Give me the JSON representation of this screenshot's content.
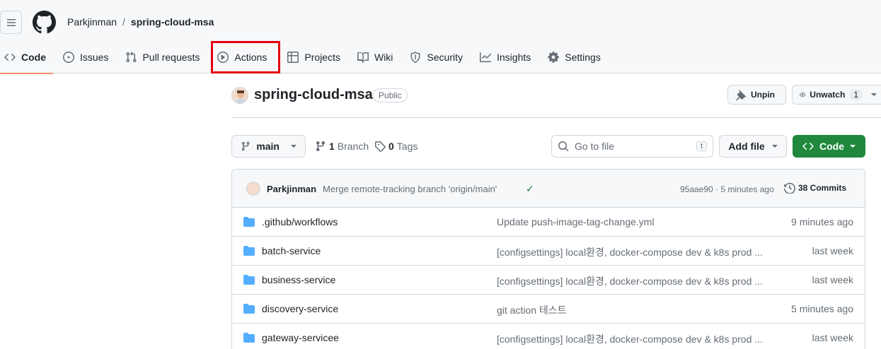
{
  "header": {
    "owner": "Parkjinman",
    "separator": "/",
    "repo": "spring-cloud-msa"
  },
  "tabs": [
    {
      "label": "Code",
      "icon": "code-icon"
    },
    {
      "label": "Issues",
      "icon": "issue-icon"
    },
    {
      "label": "Pull requests",
      "icon": "pull-request-icon"
    },
    {
      "label": "Actions",
      "icon": "play-icon"
    },
    {
      "label": "Projects",
      "icon": "table-icon"
    },
    {
      "label": "Wiki",
      "icon": "book-icon"
    },
    {
      "label": "Security",
      "icon": "shield-icon"
    },
    {
      "label": "Insights",
      "icon": "graph-icon"
    },
    {
      "label": "Settings",
      "icon": "gear-icon"
    }
  ],
  "repo": {
    "name": "spring-cloud-msa",
    "visibility": "Public",
    "unpin_label": "Unpin",
    "unwatch_label": "Unwatch",
    "watch_count": "1"
  },
  "toolbar": {
    "branch": "main",
    "branches_count": "1",
    "branches_label": "Branch",
    "tags_count": "0",
    "tags_label": "Tags",
    "goto_placeholder": "Go to file",
    "goto_shortcut": "t",
    "add_file": "Add file",
    "code": "Code"
  },
  "latest_commit": {
    "author": "Parkjinman",
    "message": "Merge remote-tracking branch 'origin/main'",
    "status": "✓",
    "hash_time": "95aae90 · 5 minutes ago",
    "commits_label": "38 Commits"
  },
  "files": [
    {
      "name": ".github/workflows",
      "message": "Update push-image-tag-change.yml",
      "time": "9 minutes ago"
    },
    {
      "name": "batch-service",
      "message": "[configsettings] local환경, docker-compose dev & k8s prod ...",
      "time": "last week"
    },
    {
      "name": "business-service",
      "message": "[configsettings] local환경, docker-compose dev & k8s prod ...",
      "time": "last week"
    },
    {
      "name": "discovery-service",
      "message": "git action 테스트",
      "time": "5 minutes ago"
    },
    {
      "name": "gateway-servicee",
      "message": "[configsettings] local환경, docker-compose dev & k8s prod ...",
      "time": "last week"
    }
  ]
}
